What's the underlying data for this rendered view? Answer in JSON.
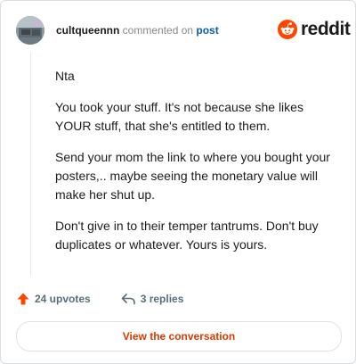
{
  "header": {
    "username": "cultqueennn",
    "action": " commented on ",
    "post_link": "post"
  },
  "logo": {
    "text": "reddit",
    "color": "#ff4500"
  },
  "comment": {
    "paragraphs": [
      "Nta",
      "You took your stuff. It's not because she likes YOUR stuff, that she's entitled to them.",
      "Send your mom the link to where you bought your posters,.. maybe seeing the monetary value will make her shut up.",
      "Don't give in to their temper tantrums. Don't buy duplicates or whatever. Yours is yours."
    ]
  },
  "footer": {
    "upvotes": "24 upvotes",
    "replies": "3 replies",
    "upvote_icon": "upvote-arrow-icon",
    "reply_icon": "reply-arrow-icon"
  },
  "cta": {
    "label": "View the conversation"
  },
  "colors": {
    "accent": "#d93a00",
    "upvote": "#ff4500",
    "link": "#0a5fab"
  }
}
